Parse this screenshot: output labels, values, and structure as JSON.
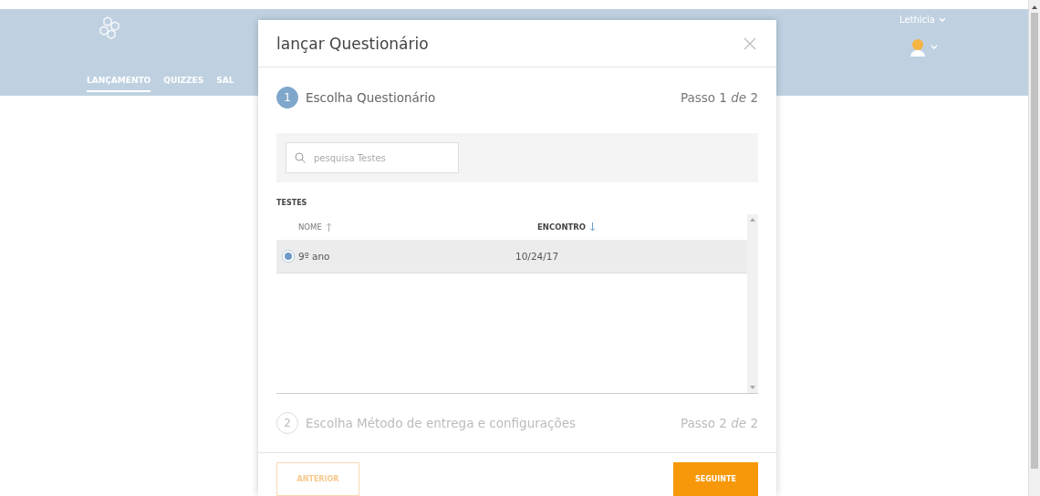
{
  "header": {
    "nav": [
      {
        "label": "LANÇAMENTO",
        "selected": true
      },
      {
        "label": "QUIZZES",
        "selected": false
      },
      {
        "label": "SAL",
        "selected": false
      }
    ],
    "user": "Lethicia"
  },
  "dialog": {
    "title": "lançar Questionário",
    "steps": [
      {
        "number": "1",
        "title": "Escolha Questionário",
        "counter": "Passo 1 *de* 2",
        "active": true
      },
      {
        "number": "2",
        "title": "Escolha Método de entrega e configurações",
        "counter": "Passo 2 *de* 2",
        "active": false
      }
    ],
    "search": {
      "placeholder": "pesquisa Testes"
    },
    "table": {
      "label": "TESTES",
      "columns": [
        {
          "label": "NOME",
          "ascending": true,
          "active": false
        },
        {
          "label": "ENCONTRO",
          "ascending": false,
          "active": true
        }
      ],
      "rows": [
        {
          "cells": [
            "9º ano",
            "10/24/17"
          ],
          "selected": true
        }
      ]
    },
    "buttons": [
      {
        "label": "ANTERIOR",
        "kind": "secondary",
        "disabled": true
      },
      {
        "label": "SEGUINTE",
        "kind": "primary",
        "disabled": false
      }
    ]
  }
}
